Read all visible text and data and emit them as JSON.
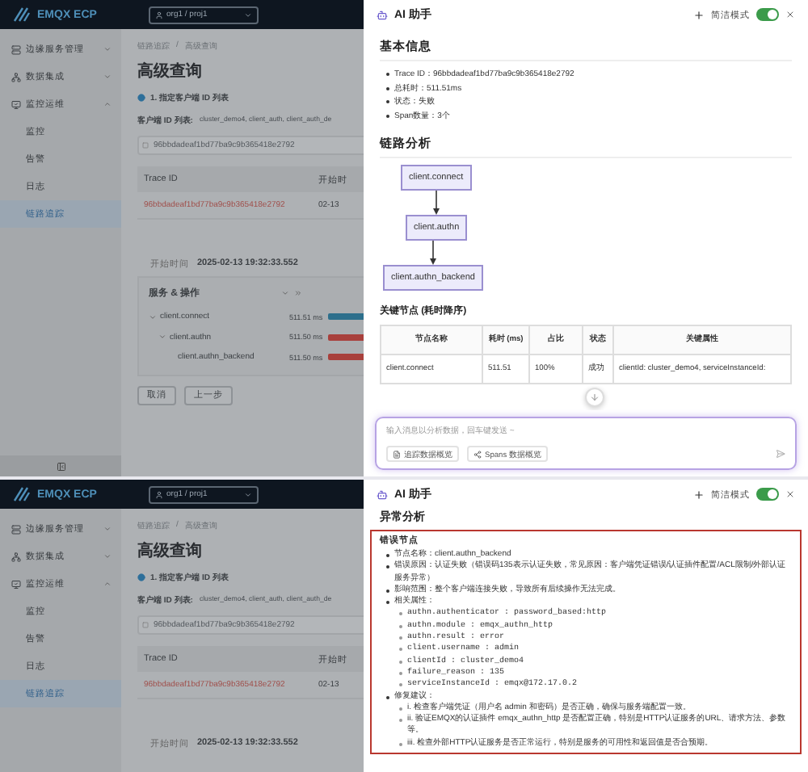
{
  "screens": [
    {
      "app": {
        "logo": "EMQX ECP",
        "project": "org1 / proj1",
        "sidebar": {
          "collapse_control": true,
          "items": [
            {
              "label": "边缘服务管理",
              "expanded": false
            },
            {
              "label": "数据集成",
              "expanded": false
            },
            {
              "label": "监控运维",
              "expanded": true,
              "children": [
                {
                  "label": "监控",
                  "selected": false
                },
                {
                  "label": "告警",
                  "selected": false
                },
                {
                  "label": "日志",
                  "selected": false
                },
                {
                  "label": "链路追踪",
                  "selected": true
                }
              ]
            }
          ]
        },
        "breadcrumb": {
          "items": [
            "链路追踪",
            "高级查询"
          ],
          "separator": "/"
        },
        "title": "高级查询",
        "step": "1. 指定客户端 ID 列表",
        "client_ids": {
          "label": "客户端 ID 列表:",
          "value": "cluster_demo4,  client_auth,  client_auth_de"
        },
        "trace_search": {
          "value": "96bbdadeaf1bd77ba9c9b365418e2792"
        },
        "table": {
          "columns": [
            "Trace ID",
            "开始时"
          ],
          "rows": [
            [
              "96bbdadeaf1bd77ba9c9b365418e2792",
              "02-13"
            ]
          ]
        },
        "start_time": {
          "label": "开始时间",
          "value": "2025-02-13 19:32:33.552"
        },
        "spans": {
          "heading": "服务 & 操作",
          "items": [
            {
              "name": "client.connect",
              "duration": "511.51 ms",
              "color": "#2d6f8c",
              "expanded": true,
              "children": [
                {
                  "name": "client.authn",
                  "duration": "511.50 ms",
                  "color": "#a8403c",
                  "expanded": true,
                  "children": [
                    {
                      "name": "client.authn_backend",
                      "duration": "511.50 ms",
                      "color": "#a8403c"
                    }
                  ]
                }
              ]
            }
          ]
        },
        "buttons": [
          "取消",
          "上一步"
        ]
      },
      "drawer": {
        "title": "AI 助手",
        "mode_label": "简洁模式",
        "mode_on": true,
        "scroll_button": true,
        "sections": [
          {
            "kind": "bullets",
            "heading": "基本信息",
            "items": [
              "Trace ID：96bbdadeaf1bd77ba9c9b365418e2792",
              "总耗时：511.51ms",
              "状态：失败",
              "Span数量：3个"
            ]
          },
          {
            "kind": "flow",
            "heading": "链路分析",
            "nodes": [
              "client.connect",
              "client.authn",
              "client.authn_backend"
            ]
          },
          {
            "kind": "table",
            "heading": "关键节点 (耗时降序)",
            "columns": [
              "节点名称",
              "耗时 (ms)",
              "占比",
              "状态",
              "关键属性"
            ],
            "rows": [
              [
                "client.connect",
                "511.51",
                "100%",
                "成功",
                "clientId: cluster_demo4, serviceInstanceId:"
              ]
            ]
          }
        ],
        "composer": {
          "placeholder": "输入消息以分析数据，回车键发送 ~",
          "chips": [
            "追踪数据概览",
            "Spans 数据概览"
          ]
        }
      }
    },
    {
      "app": {
        "logo": "EMQX ECP",
        "project": "org1 / proj1",
        "sidebar": {
          "items": [
            {
              "label": "边缘服务管理",
              "expanded": false
            },
            {
              "label": "数据集成",
              "expanded": false
            },
            {
              "label": "监控运维",
              "expanded": true,
              "children": [
                {
                  "label": "监控",
                  "selected": false
                },
                {
                  "label": "告警",
                  "selected": false
                },
                {
                  "label": "日志",
                  "selected": false
                },
                {
                  "label": "链路追踪",
                  "selected": true
                }
              ]
            }
          ]
        },
        "breadcrumb": {
          "items": [
            "链路追踪",
            "高级查询"
          ],
          "separator": "/"
        },
        "title": "高级查询",
        "step": "1. 指定客户端 ID 列表",
        "client_ids": {
          "label": "客户端 ID 列表:",
          "value": "cluster_demo4,  client_auth,  client_auth_de"
        },
        "trace_search": {
          "value": "96bbdadeaf1bd77ba9c9b365418e2792"
        },
        "table": {
          "columns": [
            "Trace ID",
            "开始时"
          ],
          "rows": [
            [
              "96bbdadeaf1bd77ba9c9b365418e2792",
              "02-13"
            ]
          ]
        },
        "start_time": {
          "label": "开始时间",
          "value": "2025-02-13 19:32:33.552"
        }
      },
      "drawer": {
        "title": "AI 助手",
        "mode_label": "简洁模式",
        "mode_on": true,
        "sections": [
          {
            "kind": "alert",
            "heading": "异常分析",
            "title": "错误节点",
            "items": [
              {
                "text": "节点名称：client.authn_backend"
              },
              {
                "text": "错误原因：认证失败（错误码135表示认证失败，常见原因：客户端凭证错误/认证插件配置/ACL限制/外部认证服务异常）"
              },
              {
                "text": "影响范围：整个客户端连接失败，导致所有后续操作无法完成。"
              },
              {
                "text": "相关属性：",
                "children": [
                  "authn.authenticator : password_based:http",
                  "authn.module : emqx_authn_http",
                  "authn.result : error",
                  "client.username : admin",
                  "clientId : cluster_demo4",
                  "failure_reason : 135",
                  "serviceInstanceId : emqx@172.17.0.2"
                ]
              },
              {
                "text": "修复建议：",
                "children": [
                  "i. 检查客户端凭证（用户名 admin 和密码）是否正确，确保与服务端配置一致。",
                  "ii. 验证EMQX的认证插件 emqx_authn_http 是否配置正确，特别是HTTP认证服务的URL、请求方法、参数等。",
                  "iii. 检查外部HTTP认证服务是否正常运行，特别是服务的可用性和返回值是否合预期。"
                ]
              }
            ]
          }
        ]
      }
    }
  ]
}
